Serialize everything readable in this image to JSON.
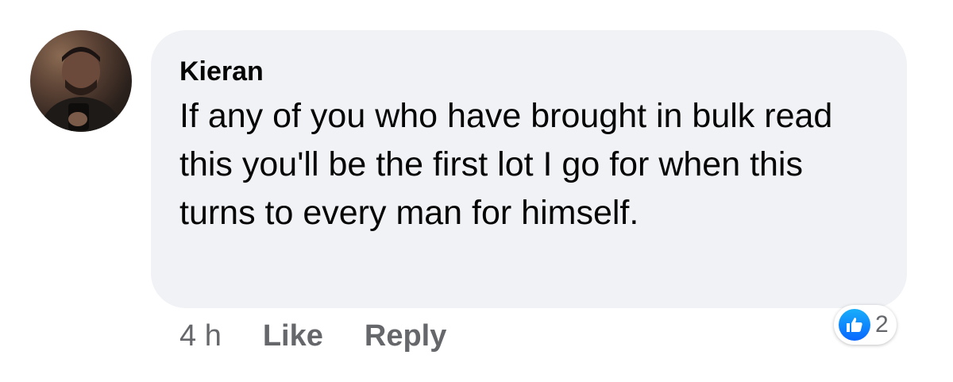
{
  "comment": {
    "author": "Kieran",
    "text": "If any of you who have brought in bulk read this you'll be the first lot I go for when this turns to every man for himself.",
    "timestamp": "4 h",
    "like_label": "Like",
    "reply_label": "Reply",
    "reaction_count": "2",
    "reaction_type": "like-icon"
  },
  "colors": {
    "bubble": "#f0f2f5",
    "text": "#050505",
    "secondary_text": "#65676b",
    "like_blue": "#0866ff"
  }
}
